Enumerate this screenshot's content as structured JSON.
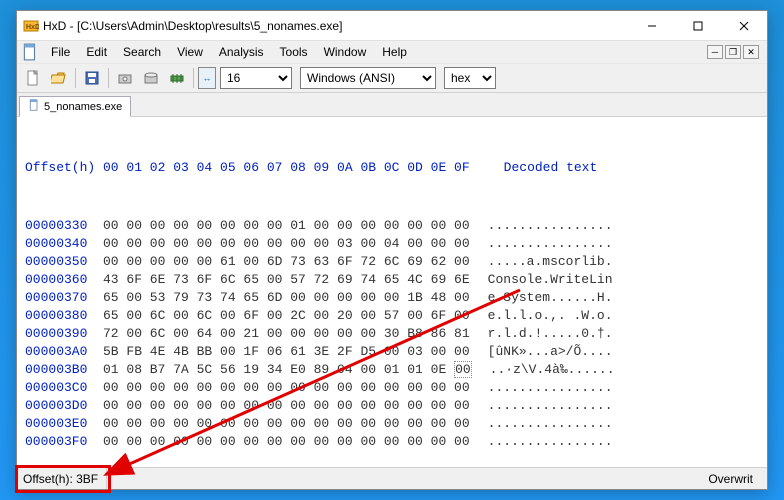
{
  "titlebar": {
    "app_icon_text": "HxD",
    "title": "HxD - [C:\\Users\\Admin\\Desktop\\results\\5_nonames.exe]"
  },
  "menubar": {
    "items": [
      "File",
      "Edit",
      "Search",
      "View",
      "Analysis",
      "Tools",
      "Window",
      "Help"
    ]
  },
  "toolbar": {
    "bytes_per_row": "16",
    "encoding": "Windows (ANSI)",
    "base": "hex"
  },
  "tab": {
    "label": "5_nonames.exe"
  },
  "hex": {
    "header_offset": "Offset(h)",
    "header_cols": "00 01 02 03 04 05 06 07 08 09 0A 0B 0C 0D 0E 0F",
    "header_decoded": "Decoded text",
    "rows": [
      {
        "off": "00000330",
        "bytes": "00 00 00 00 00 00 00 00 01 00 00 00 00 00 00 00",
        "ascii": "................"
      },
      {
        "off": "00000340",
        "bytes": "00 00 00 00 00 00 00 00 00 00 03 00 04 00 00 00",
        "ascii": "................"
      },
      {
        "off": "00000350",
        "bytes": "00 00 00 00 00 61 00 6D 73 63 6F 72 6C 69 62 00",
        "ascii": ".....a.mscorlib."
      },
      {
        "off": "00000360",
        "bytes": "43 6F 6E 73 6F 6C 65 00 57 72 69 74 65 4C 69 6E",
        "ascii": "Console.WriteLin"
      },
      {
        "off": "00000370",
        "bytes": "65 00 53 79 73 74 65 6D 00 00 00 00 00 1B 48 00",
        "ascii": "e.System......H."
      },
      {
        "off": "00000380",
        "bytes": "65 00 6C 00 6C 00 6F 00 2C 00 20 00 57 00 6F 00",
        "ascii": "e.l.l.o.,. .W.o."
      },
      {
        "off": "00000390",
        "bytes": "72 00 6C 00 64 00 21 00 00 00 00 00 30 B8 86 81",
        "ascii": "r.l.d.!.....0.†."
      },
      {
        "off": "000003A0",
        "bytes": "5B FB 4E 4B BB 00 1F 06 61 3E 2F D5 00 03 00 00",
        "ascii": "[ûNK»...a>/Õ...."
      },
      {
        "off": "000003B0",
        "bytes": "01 08 B7 7A 5C 56 19 34 E0 89 04 00 01 01 0E",
        "ascii": "..·z\\V.4à‰......",
        "last": "00"
      },
      {
        "off": "000003C0",
        "bytes": "00 00 00 00 00 00 00 00 00 00 00 00 00 00 00 00",
        "ascii": "................"
      },
      {
        "off": "000003D0",
        "bytes": "00 00 00 00 00 00 00 00 00 00 00 00 00 00 00 00",
        "ascii": "................"
      },
      {
        "off": "000003E0",
        "bytes": "00 00 00 00 00 00 00 00 00 00 00 00 00 00 00 00",
        "ascii": "................"
      },
      {
        "off": "000003F0",
        "bytes": "00 00 00 00 00 00 00 00 00 00 00 00 00 00 00 00",
        "ascii": "................"
      }
    ]
  },
  "statusbar": {
    "offset_label": "Offset(h): 3BF",
    "overwrite": "Overwrit"
  }
}
